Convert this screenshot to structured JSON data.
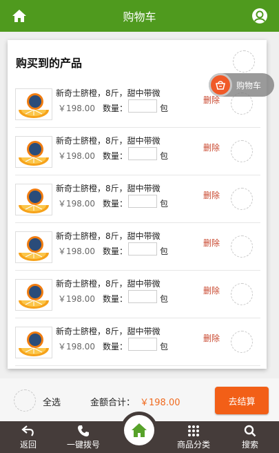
{
  "header": {
    "title": "购物车"
  },
  "section_title": "购买到的产品",
  "float_cart_label": "购物车",
  "items": [
    {
      "name": "新奇士脐橙，8斤，甜中带微",
      "price": "￥198.00",
      "qty_label": "数量：",
      "unit": "包",
      "delete": "删除"
    },
    {
      "name": "新奇士脐橙，8斤，甜中带微",
      "price": "￥198.00",
      "qty_label": "数量：",
      "unit": "包",
      "delete": "删除"
    },
    {
      "name": "新奇士脐橙，8斤，甜中带微",
      "price": "￥198.00",
      "qty_label": "数量：",
      "unit": "包",
      "delete": "删除"
    },
    {
      "name": "新奇士脐橙，8斤，甜中带微",
      "price": "￥198.00",
      "qty_label": "数量：",
      "unit": "包",
      "delete": "删除"
    },
    {
      "name": "新奇士脐橙，8斤，甜中带微",
      "price": "￥198.00",
      "qty_label": "数量：",
      "unit": "包",
      "delete": "删除"
    },
    {
      "name": "新奇士脐橙，8斤，甜中带微",
      "price": "￥198.00",
      "qty_label": "数量：",
      "unit": "包",
      "delete": "删除"
    }
  ],
  "summary": {
    "select_all": "全选",
    "total_label": "金额合计：",
    "total_value": "￥198.00",
    "checkout": "去结算"
  },
  "nav": {
    "back": "返回",
    "call": "一键拨号",
    "categories": "商品分类",
    "search": "搜索"
  },
  "colors": {
    "header": "#4f9a1e",
    "accent": "#f25f17",
    "nav_bg": "#453c3a",
    "delete": "#c9482f"
  }
}
